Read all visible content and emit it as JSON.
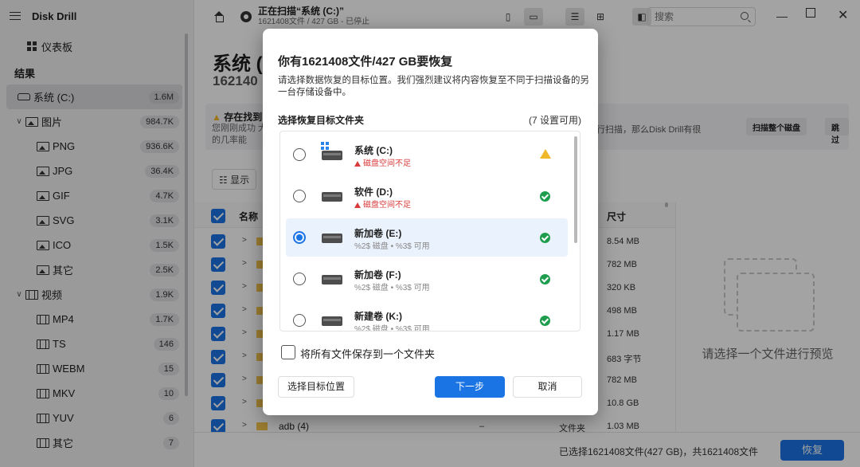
{
  "app": {
    "title": "Disk Drill"
  },
  "sidebar": {
    "dashboard": "仪表板",
    "results_header": "结果",
    "items": [
      {
        "label": "系统 (C:)",
        "count": "1.6M",
        "icon": "drive-icon",
        "level": 0,
        "chev": ""
      },
      {
        "label": "图片",
        "count": "984.7K",
        "icon": "image-icon",
        "level": 0,
        "chev": "∨"
      },
      {
        "label": "PNG",
        "count": "936.6K",
        "icon": "image-icon",
        "level": 1,
        "chev": ""
      },
      {
        "label": "JPG",
        "count": "36.4K",
        "icon": "image-icon",
        "level": 1,
        "chev": ""
      },
      {
        "label": "GIF",
        "count": "4.7K",
        "icon": "image-icon",
        "level": 1,
        "chev": ""
      },
      {
        "label": "SVG",
        "count": "3.1K",
        "icon": "image-icon",
        "level": 1,
        "chev": ""
      },
      {
        "label": "ICO",
        "count": "1.5K",
        "icon": "image-icon",
        "level": 1,
        "chev": ""
      },
      {
        "label": "其它",
        "count": "2.5K",
        "icon": "image-icon",
        "level": 1,
        "chev": ""
      },
      {
        "label": "视频",
        "count": "1.9K",
        "icon": "video-icon",
        "level": 0,
        "chev": "∨"
      },
      {
        "label": "MP4",
        "count": "1.7K",
        "icon": "video-icon",
        "level": 1,
        "chev": ""
      },
      {
        "label": "TS",
        "count": "146",
        "icon": "video-icon",
        "level": 1,
        "chev": ""
      },
      {
        "label": "WEBM",
        "count": "15",
        "icon": "video-icon",
        "level": 1,
        "chev": ""
      },
      {
        "label": "MKV",
        "count": "10",
        "icon": "video-icon",
        "level": 1,
        "chev": ""
      },
      {
        "label": "YUV",
        "count": "6",
        "icon": "video-icon",
        "level": 1,
        "chev": ""
      },
      {
        "label": "其它",
        "count": "7",
        "icon": "video-icon",
        "level": 1,
        "chev": ""
      }
    ]
  },
  "topbar": {
    "scan_title": "正在扫描“系统 (C:)”",
    "scan_sub": "1621408文件 / 427 GB - 已停止",
    "search_placeholder": "搜索"
  },
  "main": {
    "title": "系统 (",
    "count": "162140",
    "notice_title": "存在找到",
    "notice_desc": "您刚刚成功 大的几率能",
    "notice_right": "进行扫描，那么Disk Drill有很",
    "scan_all_btn": "扫描整个磁盘",
    "skip_btn": "跳过",
    "filter_label": "显示",
    "col_name": "名称",
    "col_size": "尺寸",
    "sizes": [
      "8.54 MB",
      "782 MB",
      "320 KB",
      "498 MB",
      "1.17 MB",
      "683 字节",
      "782 MB",
      "10.8 GB"
    ],
    "last_row": {
      "name": "adb (4)",
      "dash": "–",
      "type": "文件夹",
      "size": "1.03 MB"
    },
    "preview_text": "请选择一个文件进行预览",
    "summary": "已选择1621408文件(427 GB)，共1621408文件",
    "recover_btn": "恢复"
  },
  "modal": {
    "title": "你有1621408文件/427 GB要恢复",
    "desc": "请选择数据恢复的目标位置。我们强烈建议将内容恢复至不同于扫描设备的另一台存储设备中。",
    "subtitle": "选择恢复目标文件夹",
    "available": "(7 设置可用)",
    "destinations": [
      {
        "name": "系统 (C:)",
        "info": "磁盘空间不足",
        "error": true,
        "status": "warn",
        "selected": false
      },
      {
        "name": "软件 (D:)",
        "info": "磁盘空间不足",
        "error": true,
        "status": "ok",
        "selected": false
      },
      {
        "name": "新加卷 (E:)",
        "info": "%2$ 磁盘 • %3$ 可用",
        "error": false,
        "status": "ok",
        "selected": true
      },
      {
        "name": "新加卷 (F:)",
        "info": "%2$ 磁盘 • %3$ 可用",
        "error": false,
        "status": "ok",
        "selected": false
      },
      {
        "name": "新建卷 (K:)",
        "info": "%2$ 磁盘 • %3$ 可用",
        "error": false,
        "status": "ok",
        "selected": false
      }
    ],
    "single_folder_label": "将所有文件保存到一个文件夹",
    "choose_btn": "选择目标位置",
    "next_btn": "下一步",
    "cancel_btn": "取消"
  },
  "colors": {
    "accent": "#1b74e4",
    "ok": "#1f9d4e",
    "warn": "#f1b72a",
    "error": "#d93a3a"
  }
}
